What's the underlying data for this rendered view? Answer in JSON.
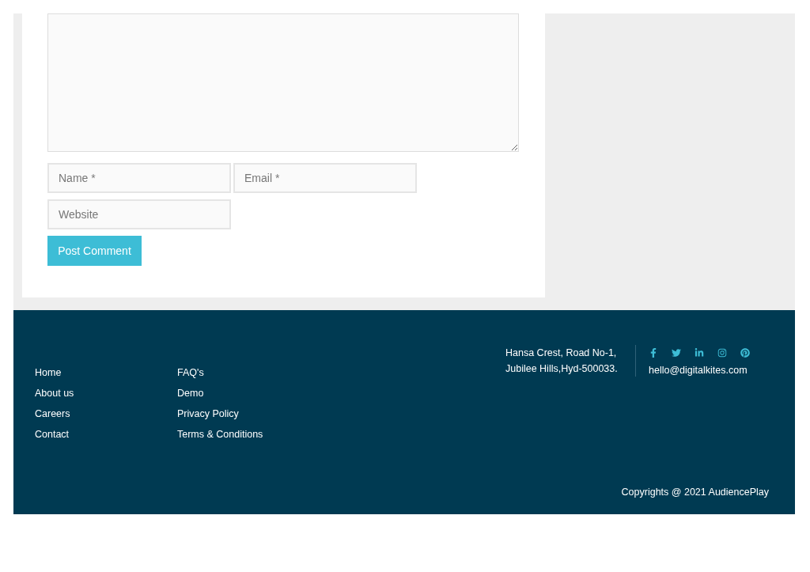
{
  "comment_form": {
    "fields": [
      {
        "placeholder": "Name *"
      },
      {
        "placeholder": "Email *"
      },
      {
        "placeholder": "Website"
      }
    ],
    "submit": "Post Comment"
  },
  "footer": {
    "columns": [
      [
        "Home",
        "About us",
        "Careers",
        "Contact"
      ],
      [
        "FAQ's",
        "Demo",
        "Privacy Policy",
        "Terms & Conditions"
      ]
    ],
    "address": [
      "Hansa Crest, Road No-1,",
      "Jubilee Hills,Hyd-500033."
    ],
    "email": "hello@digitalkites.com",
    "copyright": "Copyrights @ 2021 AudiencePlay"
  }
}
